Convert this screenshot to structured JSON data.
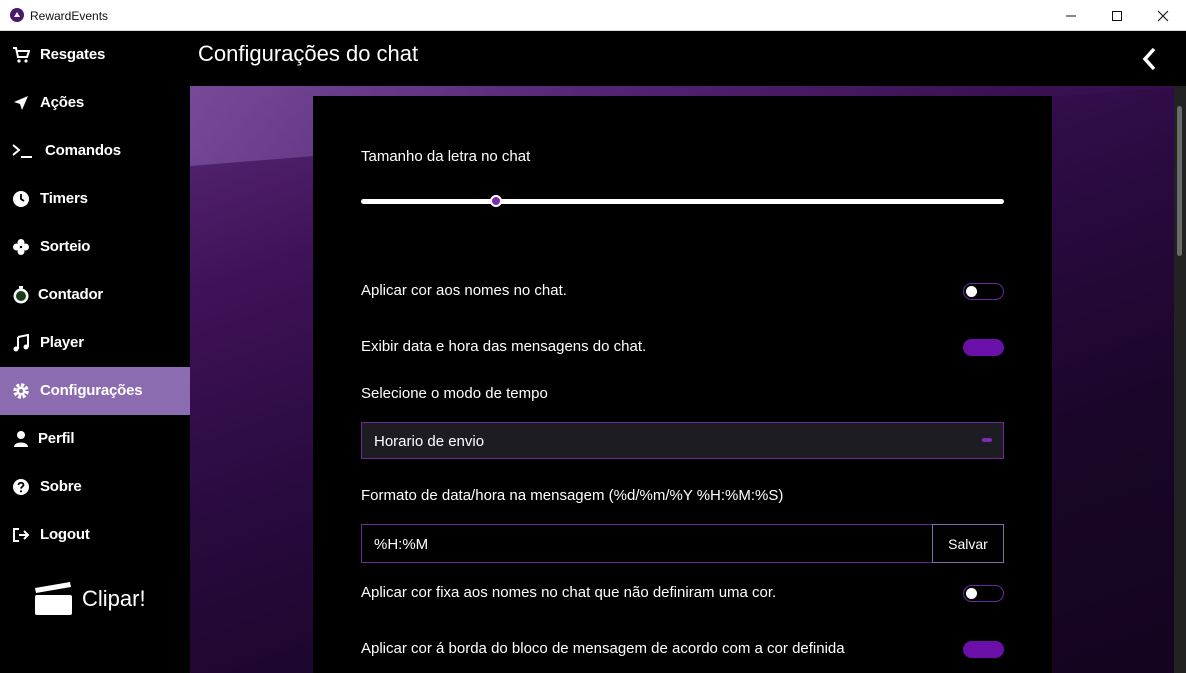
{
  "window": {
    "title": "RewardEvents"
  },
  "sidebar": {
    "items": [
      {
        "label": "Resgates",
        "icon": "cart-icon"
      },
      {
        "label": "Ações",
        "icon": "send-arrow-icon"
      },
      {
        "label": "Comandos",
        "icon": "terminal-icon"
      },
      {
        "label": "Timers",
        "icon": "clock-icon"
      },
      {
        "label": "Sorteio",
        "icon": "clover-icon"
      },
      {
        "label": "Contador",
        "icon": "stopwatch-icon"
      },
      {
        "label": "Player",
        "icon": "music-note-icon"
      },
      {
        "label": "Configurações",
        "icon": "gear-icon",
        "active": true
      },
      {
        "label": "Perfil",
        "icon": "user-icon"
      },
      {
        "label": "Sobre",
        "icon": "help-circle-icon"
      },
      {
        "label": "Logout",
        "icon": "logout-icon"
      }
    ],
    "clip_label": "Clipar!",
    "clip_icon": "clapperboard-icon"
  },
  "header": {
    "title": "Configurações do chat",
    "back_icon": "chevron-left-icon"
  },
  "settings": {
    "font_size_label": "Tamanho da letra no chat",
    "font_size_value": 0.21,
    "color_names_label": "Aplicar cor aos nomes no chat.",
    "color_names_on": false,
    "show_datetime_label": "Exibir data e hora das mensagens do chat.",
    "show_datetime_on": true,
    "time_mode_label": "Selecione o modo de tempo",
    "time_mode_value": "Horario de envio",
    "format_label": "Formato de data/hora na mensagem (%d/%m/%Y %H:%M:%S)",
    "format_value": "%H:%M",
    "save_label": "Salvar",
    "fixed_color_label": "Aplicar cor fixa aos nomes no chat que não definiram uma cor.",
    "fixed_color_on": false,
    "border_color_label": "Aplicar cor á borda do bloco de mensagem de acordo com a cor definida",
    "border_color_on": true
  },
  "colors": {
    "accent": "#6a0fa8",
    "active_nav": "#8c6cb0"
  }
}
